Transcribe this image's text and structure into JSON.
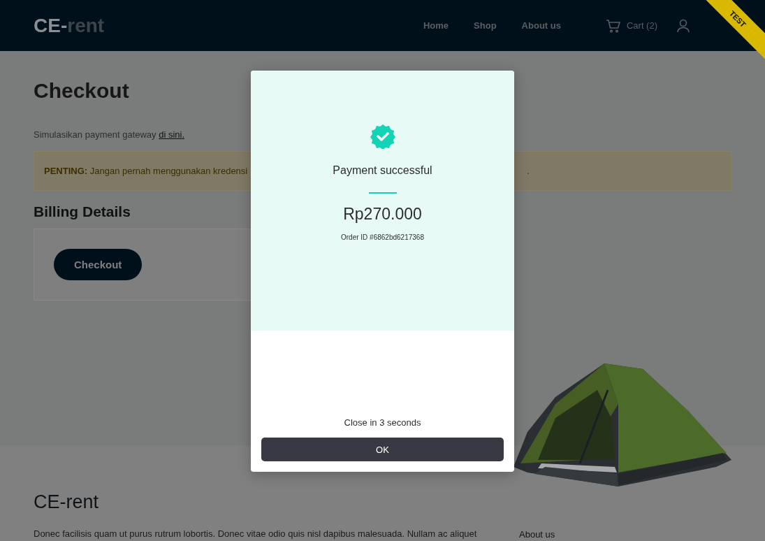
{
  "header": {
    "logo": {
      "first": "CE-",
      "second": "rent"
    },
    "nav": [
      "Home",
      "Shop",
      "About us"
    ],
    "cart": "Cart (2)",
    "ribbon": "TEST"
  },
  "page": {
    "title": "Checkout",
    "gateway": {
      "text": "Simulasikan payment gateway ",
      "link": "di sini."
    },
    "alert": {
      "label": "PENTING:",
      "text": " Jangan pernah menggunakan kredensi",
      "tail": "."
    },
    "billing_title": "Billing Details",
    "checkout_button": "Checkout"
  },
  "modal": {
    "status": "Payment successful",
    "amount": "Rp270.000",
    "order_id": "Order ID #6862bd6217368",
    "countdown": "Close in 3 seconds",
    "ok_button": "OK"
  },
  "footer": {
    "title": "CE-rent",
    "text": "Donec facilisis quam ut purus rutrum lobortis. Donec vitae odio quis nisl dapibus malesuada. Nullam ac aliquet",
    "about": "About us"
  }
}
